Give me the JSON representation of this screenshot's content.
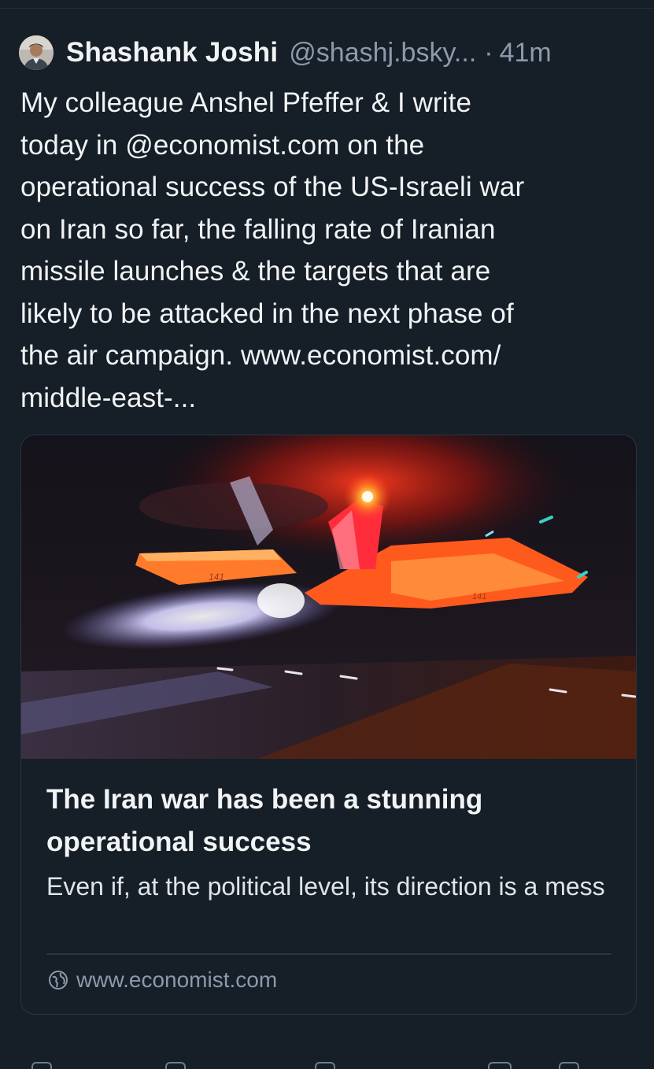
{
  "post": {
    "author_name": "Shashank Joshi",
    "author_handle": "@shashj.bsky...",
    "separator": "·",
    "time": "41m",
    "text": "My colleague Anshel Pfeffer & I write\ntoday in @economist.com on the\noperational success of the US-Israeli war\non Iran so far, the falling rate of Iranian\nmissile launches & the targets that are\nlikely to be attacked in the next phase of\nthe air campaign. www.economist.com/\nmiddle-east-..."
  },
  "link_card": {
    "image_description_icon": "fighter-jet-photo",
    "jet_number_left": "141",
    "jet_number_right": "141",
    "title": "The Iran war has been a stunning operational success",
    "description": "Even if, at the political level, its direction is a mess",
    "domain": "www.economist.com",
    "domain_icon": "globe-icon"
  },
  "colors": {
    "background": "#161e27",
    "text": "#f1f3f5",
    "muted": "#8c9aab",
    "border": "#2a3644"
  }
}
